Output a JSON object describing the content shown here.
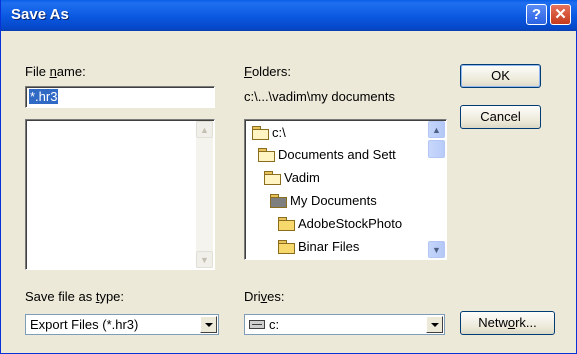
{
  "window": {
    "title": "Save As",
    "help_glyph": "?",
    "close_glyph": "✕"
  },
  "file_name": {
    "label_pre": "File ",
    "label_key": "n",
    "label_post": "ame:",
    "value": "*.hr3"
  },
  "folders": {
    "label_key": "F",
    "label_post": "olders:",
    "path": "c:\\...\\vadim\\my documents",
    "tree": [
      {
        "label": "c:\\",
        "icon": "open-folder-icon"
      },
      {
        "label": "Documents and Sett",
        "icon": "open-folder-icon"
      },
      {
        "label": "Vadim",
        "icon": "open-folder-icon"
      },
      {
        "label": "My Documents",
        "icon": "open-folder-icon"
      },
      {
        "label": "AdobeStockPhoto",
        "icon": "folder-icon"
      },
      {
        "label": "Binar Files",
        "icon": "folder-icon"
      }
    ]
  },
  "buttons": {
    "ok": "OK",
    "cancel": "Cancel",
    "network_pre": "Netw",
    "network_key": "o",
    "network_post": "rk..."
  },
  "save_type": {
    "label_pre": "Save file as ",
    "label_key": "t",
    "label_post": "ype:",
    "value": "Export Files (*.hr3)"
  },
  "drives": {
    "label_pre": "Dri",
    "label_key": "v",
    "label_post": "es:",
    "value": "c:"
  },
  "scroll_glyphs": {
    "up": "▲",
    "down": "▼"
  }
}
